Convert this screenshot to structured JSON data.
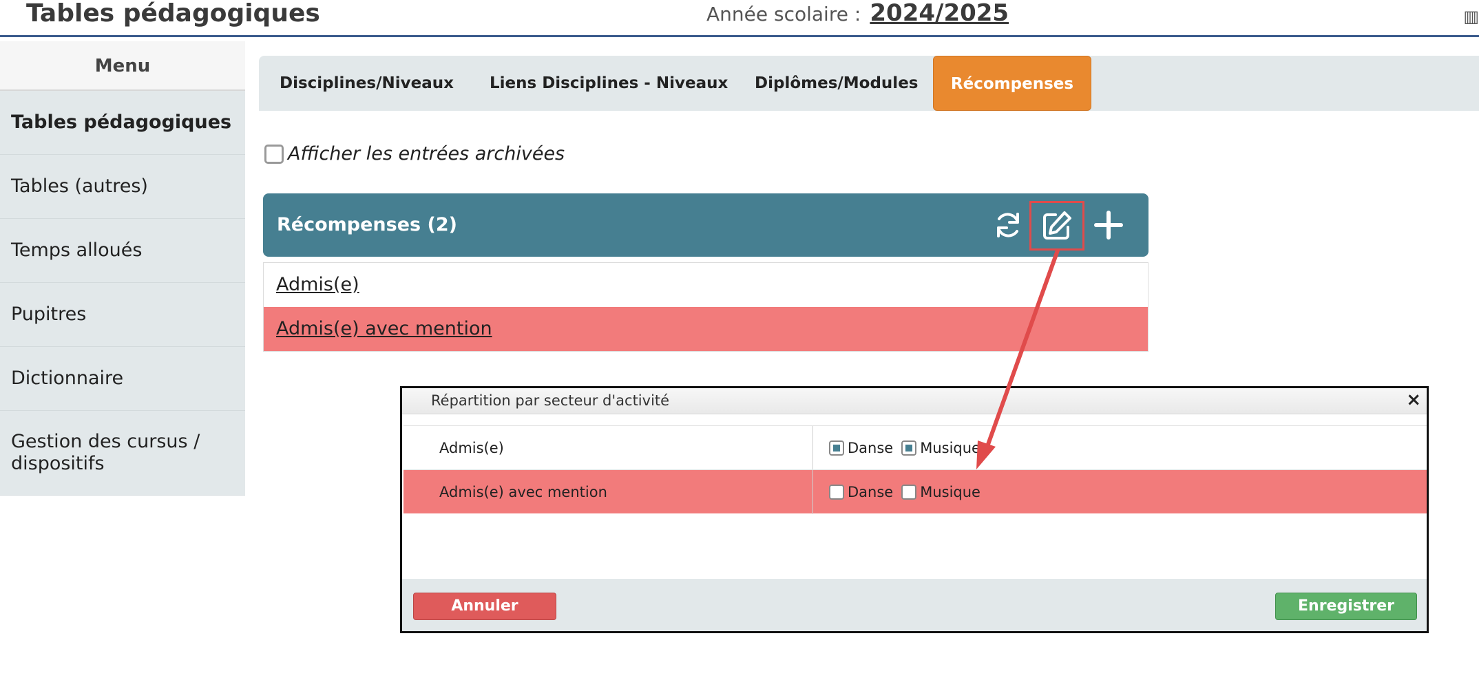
{
  "header": {
    "title": "Tables pédagogiques",
    "year_label": "Année scolaire :",
    "year_value": "2024/2025"
  },
  "sidebar": {
    "menu_label": "Menu",
    "items": [
      {
        "label": "Tables pédagogiques"
      },
      {
        "label": "Tables (autres)"
      },
      {
        "label": "Temps alloués"
      },
      {
        "label": "Pupitres"
      },
      {
        "label": "Dictionnaire"
      },
      {
        "label": "Gestion des cursus / dispositifs"
      }
    ]
  },
  "tabs": [
    {
      "label": "Disciplines/Niveaux"
    },
    {
      "label": "Liens Disciplines - Niveaux"
    },
    {
      "label": "Diplômes/Modules"
    },
    {
      "label": "Récompenses"
    }
  ],
  "archived": {
    "label": "Afficher les entrées archivées"
  },
  "panel": {
    "title": "Récompenses (2)",
    "icons": [
      "refresh-icon",
      "edit-icon",
      "plus-icon"
    ],
    "rows": [
      {
        "label": "Admis(e)"
      },
      {
        "label": "Admis(e) avec mention"
      }
    ]
  },
  "dialog": {
    "title": "Répartition par secteur d'activité",
    "close": "×",
    "rows": [
      {
        "label": "Admis(e)",
        "danse": "Danse",
        "musique": "Musique",
        "danse_checked": true,
        "musique_checked": true
      },
      {
        "label": "Admis(e) avec mention",
        "danse": "Danse",
        "musique": "Musique",
        "danse_checked": false,
        "musique_checked": false
      }
    ],
    "cancel_label": "Annuler",
    "save_label": "Enregistrer"
  },
  "colors": {
    "accent": "#467f91",
    "active_tab": "#e9892f",
    "highlight_row": "#f27b7b",
    "annotation": "#e04b4b"
  }
}
